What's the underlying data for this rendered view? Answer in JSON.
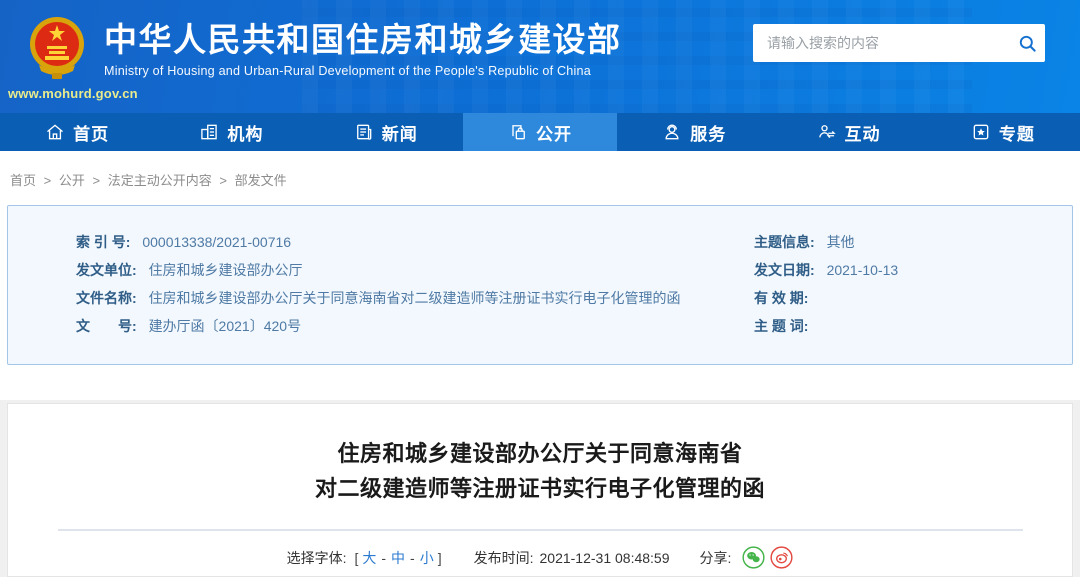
{
  "header": {
    "site_url": "www.mohurd.gov.cn",
    "title_cn": "中华人民共和国住房和城乡建设部",
    "title_en": "Ministry of Housing and Urban-Rural Development of the People's Republic of China",
    "search_placeholder": "请输入搜索的内容"
  },
  "nav": {
    "items": [
      {
        "label": "首页",
        "icon": "home-icon",
        "active": false
      },
      {
        "label": "机构",
        "icon": "organization-icon",
        "active": false
      },
      {
        "label": "新闻",
        "icon": "news-icon",
        "active": false
      },
      {
        "label": "公开",
        "icon": "disclosure-icon",
        "active": true
      },
      {
        "label": "服务",
        "icon": "service-icon",
        "active": false
      },
      {
        "label": "互动",
        "icon": "interaction-icon",
        "active": false
      },
      {
        "label": "专题",
        "icon": "topic-icon",
        "active": false
      }
    ]
  },
  "breadcrumb": {
    "separator": ">",
    "items": [
      "首页",
      "公开",
      "法定主动公开内容",
      "部发文件"
    ]
  },
  "doc_info": {
    "left": [
      {
        "label": "索 引 号:",
        "value": "000013338/2021-00716"
      },
      {
        "label": "发文单位:",
        "value": "住房和城乡建设部办公厅"
      },
      {
        "label": "文件名称:",
        "value": "住房和城乡建设部办公厅关于同意海南省对二级建造师等注册证书实行电子化管理的函"
      },
      {
        "label": "文　　号:",
        "value": "建办厅函〔2021〕420号"
      }
    ],
    "right": [
      {
        "label": "主题信息:",
        "value": "其他"
      },
      {
        "label": "发文日期:",
        "value": "2021-10-13"
      },
      {
        "label": "有 效 期:",
        "value": ""
      },
      {
        "label": "主 题 词:",
        "value": ""
      }
    ]
  },
  "article": {
    "title_line1": "住房和城乡建设部办公厅关于同意海南省",
    "title_line2": "对二级建造师等注册证书实行电子化管理的函",
    "font_label": "选择字体:",
    "bracket_open": "[",
    "bracket_close": "]",
    "font_large": "大",
    "font_medium": "中",
    "font_small": "小",
    "font_dash": "-",
    "publish_label": "发布时间:",
    "publish_time": "2021-12-31 08:48:59",
    "share_label": "分享:"
  },
  "colors": {
    "header_blue_left": "#1663c6",
    "header_blue_right": "#0a84e6",
    "nav_blue": "#0a5fb4",
    "nav_active_blue": "#2e89dc",
    "panel_bg": "#f2f8fd",
    "panel_border": "#a3c6e8",
    "label_blue": "#2f5d87",
    "value_blue": "#4f7aa5",
    "link_blue": "#2b7bd0",
    "wechat_green": "#45b44b",
    "weibo_red": "#e34a41"
  }
}
